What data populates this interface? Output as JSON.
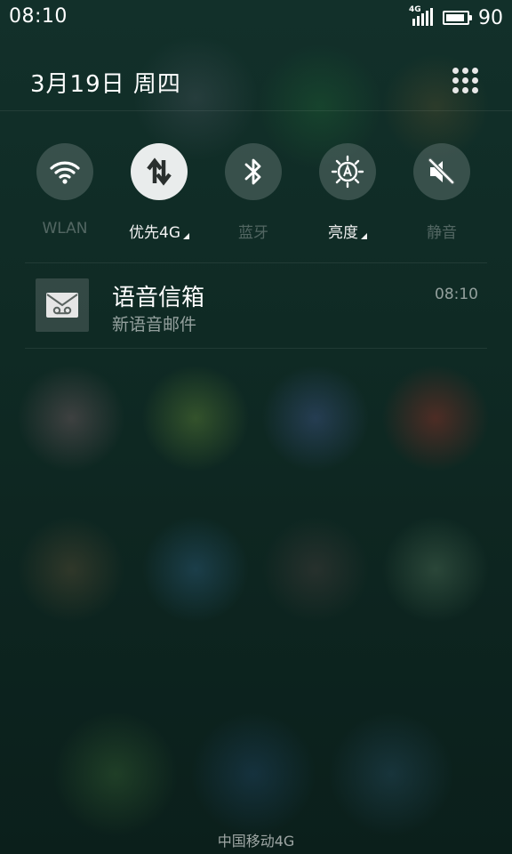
{
  "status_bar": {
    "time": "08:10",
    "network_type": "4G",
    "signal_icon": "cell-signal-icon",
    "battery_icon": "battery-icon",
    "battery_level": "90"
  },
  "header": {
    "date": "3月19日  周四",
    "settings_grid_icon": "grid-icon"
  },
  "toggles": [
    {
      "label": "WLAN",
      "icon": "wifi-icon",
      "active": false,
      "has_more": false
    },
    {
      "label": "优先4G",
      "icon": "mobile-data-icon",
      "active": true,
      "has_more": true
    },
    {
      "label": "蓝牙",
      "icon": "bluetooth-icon",
      "active": false,
      "has_more": false
    },
    {
      "label": "亮度",
      "icon": "brightness-auto-icon",
      "active": false,
      "has_more": true
    },
    {
      "label": "静音",
      "icon": "mute-icon",
      "active": false,
      "has_more": false
    }
  ],
  "notification": {
    "icon": "voicemail-icon",
    "title": "语音信箱",
    "subtitle": "新语音邮件",
    "time": "08:10"
  },
  "carrier": "中国移动4G",
  "colors": {
    "background": "#0c1e18",
    "active_toggle": "#e9ecec",
    "inactive_toggle": "#4f625e"
  }
}
